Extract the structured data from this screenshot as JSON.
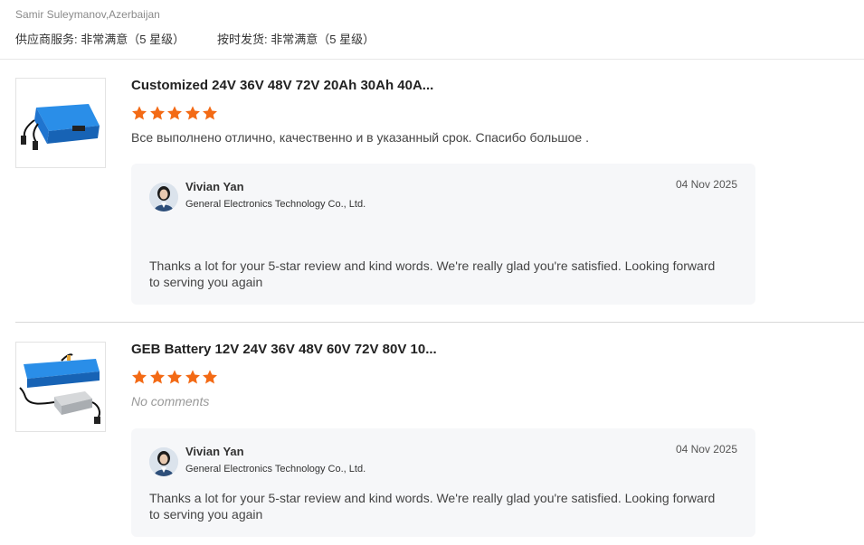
{
  "header": {
    "username": "Samir Suleymanov,Azerbaijan",
    "supplier_service": "供应商服务: 非常满意（5 星级）",
    "on_time_shipping": "按时发货: 非常满意（5 星级）"
  },
  "reviews": [
    {
      "product_title": "Customized 24V 36V 48V 72V 20Ah 30Ah 40A...",
      "rating": 5,
      "comment": "Все выполнено отлично, качественно и в указанный срок.  Спасибо большое .",
      "reply": {
        "name": "Vivian Yan",
        "company": "General Electronics Technology Co., Ltd.",
        "date": "04 Nov 2025",
        "text": "Thanks a lot for your 5-star review and kind words. We're really glad you're satisfied. Looking forward to serving you again"
      }
    },
    {
      "product_title": "GEB Battery 12V 24V 36V 48V 60V 72V 80V 10...",
      "rating": 5,
      "comment": "No comments",
      "reply": {
        "name": "Vivian Yan",
        "company": "General Electronics Technology Co., Ltd.",
        "date": "04 Nov 2025",
        "text": "Thanks a lot for your 5-star review and kind words. We're really glad you're satisfied. Looking forward to serving you again"
      }
    }
  ],
  "colors": {
    "star": "#f36a15",
    "reply_bg": "#f6f7f9",
    "product_blue": "#1e7fd8"
  },
  "icons": {
    "star": "star-icon",
    "avatar": "avatar-image"
  }
}
